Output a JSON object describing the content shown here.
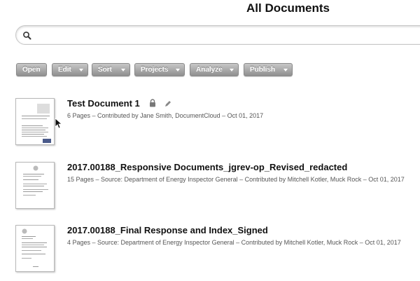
{
  "page": {
    "title": "All Documents"
  },
  "search": {
    "placeholder": "",
    "value": "",
    "icon": "search-icon"
  },
  "toolbar": {
    "buttons": [
      {
        "label": "Open",
        "dropdown": false
      },
      {
        "label": "Edit",
        "dropdown": true
      },
      {
        "label": "Sort",
        "dropdown": true
      },
      {
        "label": "Projects",
        "dropdown": true
      },
      {
        "label": "Analyze",
        "dropdown": true
      },
      {
        "label": "Publish",
        "dropdown": true
      }
    ]
  },
  "documents": [
    {
      "title": "Test Document 1",
      "meta": "6 Pages – Contributed by Jane Smith, DocumentCloud – Oct 01, 2017",
      "icons": [
        "lock-icon",
        "pencil-icon"
      ]
    },
    {
      "title": "2017.00188_Responsive Documents_jgrev-op_Revised_redacted",
      "meta": "15 Pages – Source: Department of Energy Inspector General – Contributed by Mitchell Kotler, Muck Rock – Oct 01, 2017",
      "icons": []
    },
    {
      "title": "2017.00188_Final Response and Index_Signed",
      "meta": "4 Pages – Source: Department of Energy Inspector General – Contributed by Mitchell Kotler, Muck Rock – Oct 01, 2017",
      "icons": []
    }
  ],
  "colors": {
    "button_top": "#c7c7c7",
    "button_bottom": "#8f8f8f",
    "title": "#111111",
    "meta": "#555555"
  }
}
